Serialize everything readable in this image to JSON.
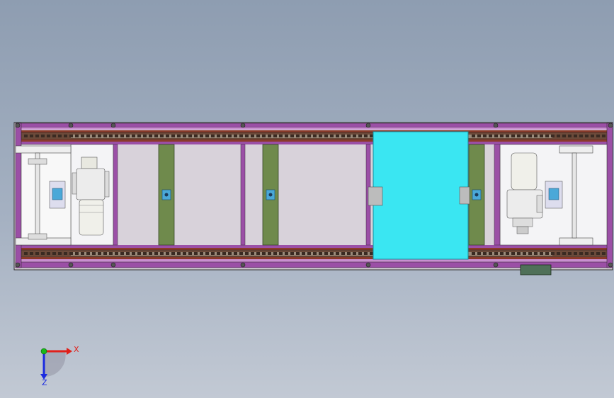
{
  "viewport": {
    "background_top": "#8e9db1",
    "background_bottom": "#c2c9d4"
  },
  "colors": {
    "frame_purple": "#9b4fa6",
    "frame_dark": "#3a2a3a",
    "chain_brown": "#6b4a3a",
    "rail_red": "#8a3a2a",
    "crossbar_olive": "#6f8a4c",
    "panel_white": "#f4f4f6",
    "pallet_cyan": "#3ae6f2",
    "motor_body": "#e8e8e0",
    "sensor_blue": "#4aa8d8",
    "base_green": "#4f7058"
  },
  "model": {
    "name": "conveyor-assembly",
    "crossbars": 4,
    "pallet": "cyan-pallet",
    "motors": [
      "left-drive-motor",
      "right-drive-motor"
    ]
  },
  "triad": {
    "x_label": "X",
    "z_label": "Z",
    "x_color": "#e0201a",
    "y_color": "#18b818",
    "z_color": "#1a2ae0"
  }
}
